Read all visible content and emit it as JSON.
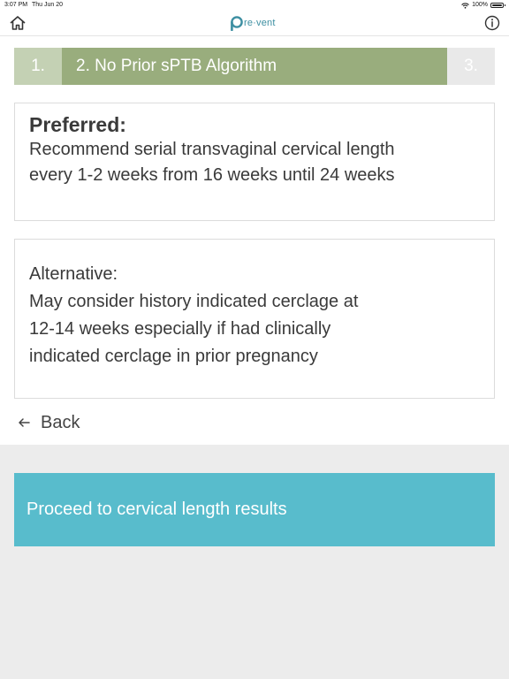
{
  "status_bar": {
    "time": "3:07 PM",
    "date": "Thu Jun 20",
    "battery": "100%"
  },
  "nav": {
    "logo_text": "re·vent",
    "home_icon": "home-icon",
    "info_icon": "info-icon"
  },
  "steps": {
    "prev_label": "1.",
    "current_label": "2. No Prior sPTB Algorithm",
    "next_label": "3."
  },
  "preferred": {
    "heading": "Preferred:",
    "lines": [
      "Recommend serial transvaginal cervical length",
      "every 1-2 weeks from 16 weeks until 24 weeks"
    ]
  },
  "alternative": {
    "heading": "Alternative:",
    "lines": [
      "May consider history indicated cerclage at",
      "12-14 weeks especially if had clinically",
      "indicated cerclage in prior pregnancy"
    ]
  },
  "back": {
    "label": "Back",
    "icon": "arrow-left-icon"
  },
  "proceed_button": {
    "label": "Proceed to cervical length results"
  },
  "colors": {
    "step_prev": "#c4d1b4",
    "step_current": "#99ad7d",
    "step_next": "#e9e9e9",
    "proceed": "#58bccc",
    "brand": "#3d8fa2"
  }
}
